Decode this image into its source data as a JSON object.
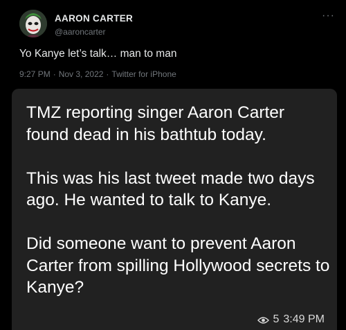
{
  "tweet": {
    "display_name": "AARON CARTER",
    "handle": "@aaroncarter",
    "text": "Yo Kanye let’s talk… man to man",
    "time": "9:27 PM",
    "date": "Nov 3, 2022",
    "client": "Twitter for iPhone",
    "more_icon": "more-horizontal-icon"
  },
  "caption": {
    "text": "TMZ reporting singer Aaron Carter found dead in his bathtub today.\n\nThis was his last tweet made two days ago. He wanted to talk to Kanye.\n\nDid someone want to prevent Aaron Carter from spilling Hollywood secrets to Kanye?"
  },
  "overlay": {
    "views": "5",
    "time": "3:49 PM",
    "icon": "eye-icon"
  },
  "colors": {
    "background": "#000000",
    "caption_bg": "#212121",
    "text_primary": "#e7e9ea",
    "text_secondary": "#71767b"
  }
}
